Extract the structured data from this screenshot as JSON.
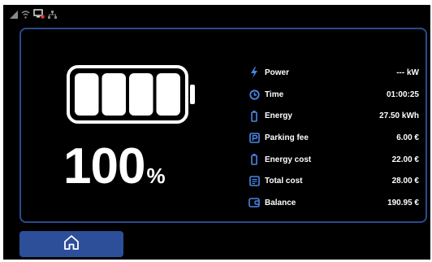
{
  "status_bar": {
    "icons": [
      "signal-icon",
      "wifi-icon",
      "display-alert-icon",
      "network-icon"
    ]
  },
  "battery": {
    "level_percent": 100,
    "percent_value": "100",
    "percent_sign": "%",
    "segments_filled": 4,
    "segments_total": 4
  },
  "metrics": [
    {
      "icon": "lightning-icon",
      "label": "Power",
      "value": "--- kW"
    },
    {
      "icon": "clock-icon",
      "label": "Time",
      "value": "01:00:25"
    },
    {
      "icon": "battery-icon",
      "label": "Energy",
      "value": "27.50 kWh"
    },
    {
      "icon": "parking-icon",
      "label": "Parking fee",
      "value": "6.00 €"
    },
    {
      "icon": "battery-icon",
      "label": "Energy cost",
      "value": "22.00 €"
    },
    {
      "icon": "receipt-icon",
      "label": "Total cost",
      "value": "28.00 €"
    },
    {
      "icon": "wallet-icon",
      "label": "Balance",
      "value": "190.95 €"
    }
  ],
  "nav": {
    "home_icon": "home-icon"
  },
  "colors": {
    "accent": "#2d4f9a",
    "panel_border": "#2a4a8f",
    "icon_blue": "#4a86e8",
    "alert_red": "#e53935",
    "background": "#000000",
    "text": "#ffffff"
  }
}
